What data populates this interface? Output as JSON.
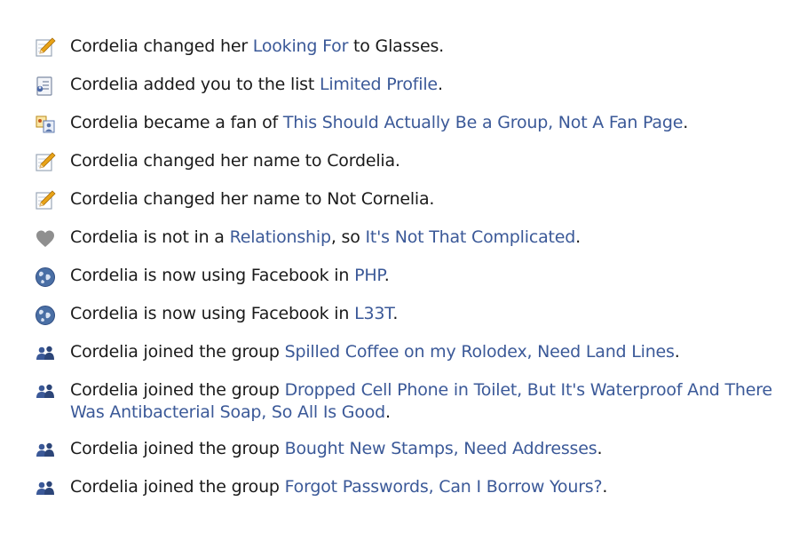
{
  "stories": [
    {
      "icon": "pencil-icon",
      "parts": [
        {
          "t": "Cordelia changed her ",
          "link": false
        },
        {
          "t": "Looking For",
          "link": true
        },
        {
          "t": " to Glasses.",
          "link": false
        }
      ]
    },
    {
      "icon": "list-icon",
      "parts": [
        {
          "t": "Cordelia added you to the list ",
          "link": false
        },
        {
          "t": "Limited Profile",
          "link": true
        },
        {
          "t": ".",
          "link": false
        }
      ]
    },
    {
      "icon": "fan-page-icon",
      "parts": [
        {
          "t": "Cordelia became a fan of ",
          "link": false
        },
        {
          "t": "This Should Actually Be a Group, Not A Fan Page",
          "link": true
        },
        {
          "t": ".",
          "link": false
        }
      ]
    },
    {
      "icon": "pencil-icon",
      "parts": [
        {
          "t": "Cordelia changed her name to Cordelia.",
          "link": false
        }
      ]
    },
    {
      "icon": "pencil-icon",
      "parts": [
        {
          "t": "Cordelia changed her name to Not Cornelia.",
          "link": false
        }
      ]
    },
    {
      "icon": "heart-icon",
      "parts": [
        {
          "t": "Cordelia is not in a ",
          "link": false
        },
        {
          "t": "Relationship",
          "link": true
        },
        {
          "t": ", so ",
          "link": false
        },
        {
          "t": "It's Not That Complicated",
          "link": true
        },
        {
          "t": ".",
          "link": false
        }
      ]
    },
    {
      "icon": "globe-icon",
      "parts": [
        {
          "t": "Cordelia is now using Facebook in ",
          "link": false
        },
        {
          "t": "PHP",
          "link": true
        },
        {
          "t": ".",
          "link": false
        }
      ]
    },
    {
      "icon": "globe-icon",
      "parts": [
        {
          "t": "Cordelia is now using Facebook in ",
          "link": false
        },
        {
          "t": "L33T",
          "link": true
        },
        {
          "t": ".",
          "link": false
        }
      ]
    },
    {
      "icon": "group-icon",
      "parts": [
        {
          "t": "Cordelia joined the group ",
          "link": false
        },
        {
          "t": "Spilled Coffee on my Rolodex, Need Land Lines",
          "link": true
        },
        {
          "t": ".",
          "link": false
        }
      ]
    },
    {
      "icon": "group-icon",
      "parts": [
        {
          "t": "Cordelia joined the group ",
          "link": false
        },
        {
          "t": "Dropped Cell Phone in Toilet, But It's Waterproof And There Was Antibacterial Soap, So All Is Good",
          "link": true
        },
        {
          "t": ".",
          "link": false
        }
      ]
    },
    {
      "icon": "group-icon",
      "parts": [
        {
          "t": "Cordelia joined the group ",
          "link": false
        },
        {
          "t": "Bought New Stamps, Need Addresses",
          "link": true
        },
        {
          "t": ".",
          "link": false
        }
      ]
    },
    {
      "icon": "group-icon",
      "parts": [
        {
          "t": "Cordelia joined the group ",
          "link": false
        },
        {
          "t": "Forgot Passwords, Can I Borrow Yours?",
          "link": true
        },
        {
          "t": ".",
          "link": false
        }
      ]
    }
  ],
  "colors": {
    "link": "#3b5998",
    "text": "#1a1a1a",
    "heart": "#8f8f8f",
    "globe": "#4a6fa5",
    "group": "#3b5998",
    "pencil": "#e8a317"
  }
}
